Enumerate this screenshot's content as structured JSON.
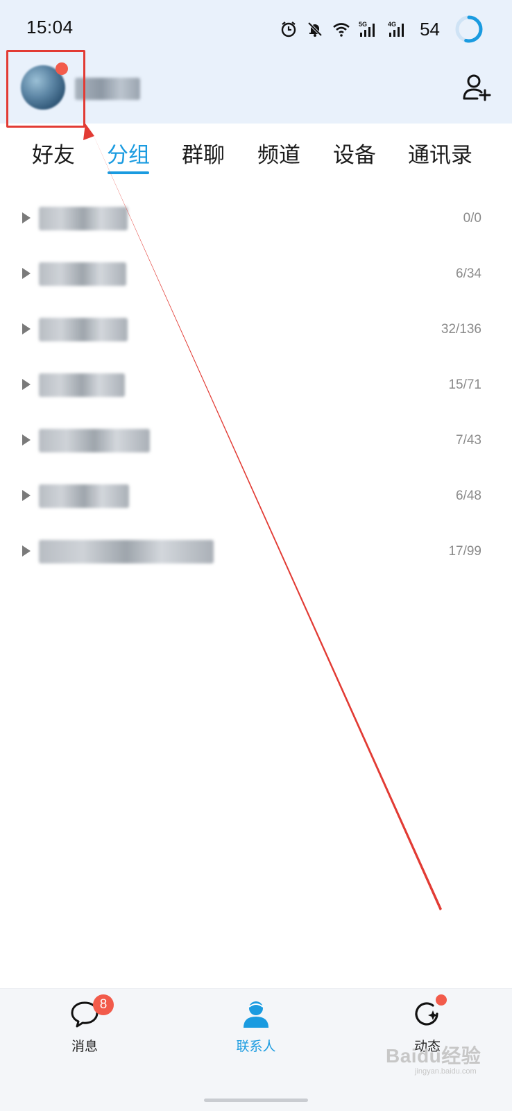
{
  "status_bar": {
    "time": "15:04",
    "network_5g": "5G",
    "network_4g": "4G",
    "battery": "54"
  },
  "header": {
    "profile_name": "",
    "add_contact_icon": "add-user-icon"
  },
  "tabs": [
    {
      "label": "好友",
      "active": false
    },
    {
      "label": "分组",
      "active": true
    },
    {
      "label": "群聊",
      "active": false
    },
    {
      "label": "频道",
      "active": false
    },
    {
      "label": "设备",
      "active": false
    },
    {
      "label": "通讯录",
      "active": false
    }
  ],
  "groups": [
    {
      "name": "",
      "count": "0/0"
    },
    {
      "name": "",
      "count": "6/34"
    },
    {
      "name": "",
      "count": "32/136"
    },
    {
      "name": "",
      "count": "15/71"
    },
    {
      "name": "",
      "count": "7/43"
    },
    {
      "name": "",
      "count": "6/48"
    },
    {
      "name": "",
      "count": "17/99"
    }
  ],
  "bottom_nav": {
    "messages": {
      "label": "消息",
      "badge": "8"
    },
    "contacts": {
      "label": "联系人"
    },
    "moments": {
      "label": "动态"
    }
  },
  "watermark": {
    "text": "Baidu经验",
    "sub": "jingyan.baidu.com"
  },
  "colors": {
    "accent": "#1a9be0",
    "badge": "#f25b4b",
    "annotation": "#e23b34",
    "header_bg": "#e9f1fb"
  }
}
